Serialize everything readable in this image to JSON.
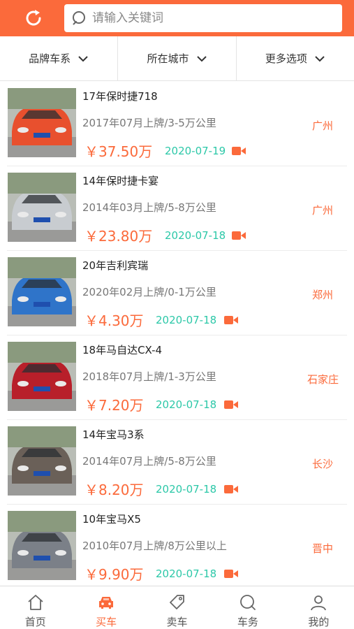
{
  "header": {
    "search_placeholder": "请输入关键词",
    "accent_color": "#fb6a3b",
    "refresh_icon": "refresh-icon",
    "search_icon": "search-icon"
  },
  "filters": [
    {
      "label": "品牌车系"
    },
    {
      "label": "所在城市"
    },
    {
      "label": "更多选项"
    }
  ],
  "listings": [
    {
      "title": "17年保时捷718",
      "info": "2017年07月上牌/3-5万公里",
      "city": "广州",
      "price": "￥37.50万",
      "date": "2020-07-19",
      "car_color": "#e8502e"
    },
    {
      "title": "14年保时捷卡宴",
      "info": "2014年03月上牌/5-8万公里",
      "city": "广州",
      "price": "￥23.80万",
      "date": "2020-07-18",
      "car_color": "#c8ccd0"
    },
    {
      "title": "20年吉利宾瑞",
      "info": "2020年02月上牌/0-1万公里",
      "city": "郑州",
      "price": "￥4.30万",
      "date": "2020-07-18",
      "car_color": "#2f74c9"
    },
    {
      "title": "18年马自达CX-4",
      "info": "2018年07月上牌/1-3万公里",
      "city": "石家庄",
      "price": "￥7.20万",
      "date": "2020-07-18",
      "car_color": "#b81f2a"
    },
    {
      "title": "14年宝马3系",
      "info": "2014年07月上牌/5-8万公里",
      "city": "长沙",
      "price": "￥8.20万",
      "date": "2020-07-18",
      "car_color": "#6a6058"
    },
    {
      "title": "10年宝马X5",
      "info": "2010年07月上牌/8万公里以上",
      "city": "晋中",
      "price": "￥9.90万",
      "date": "2020-07-18",
      "car_color": "#7b8088"
    }
  ],
  "tabs": [
    {
      "label": "首页",
      "icon": "home-icon",
      "active": false
    },
    {
      "label": "买车",
      "icon": "car-icon",
      "active": true
    },
    {
      "label": "卖车",
      "icon": "tag-icon",
      "active": false
    },
    {
      "label": "车务",
      "icon": "service-icon",
      "active": false
    },
    {
      "label": "我的",
      "icon": "user-icon",
      "active": false
    }
  ],
  "colors": {
    "accent": "#fb6a3b",
    "date": "#2cc8a8"
  }
}
